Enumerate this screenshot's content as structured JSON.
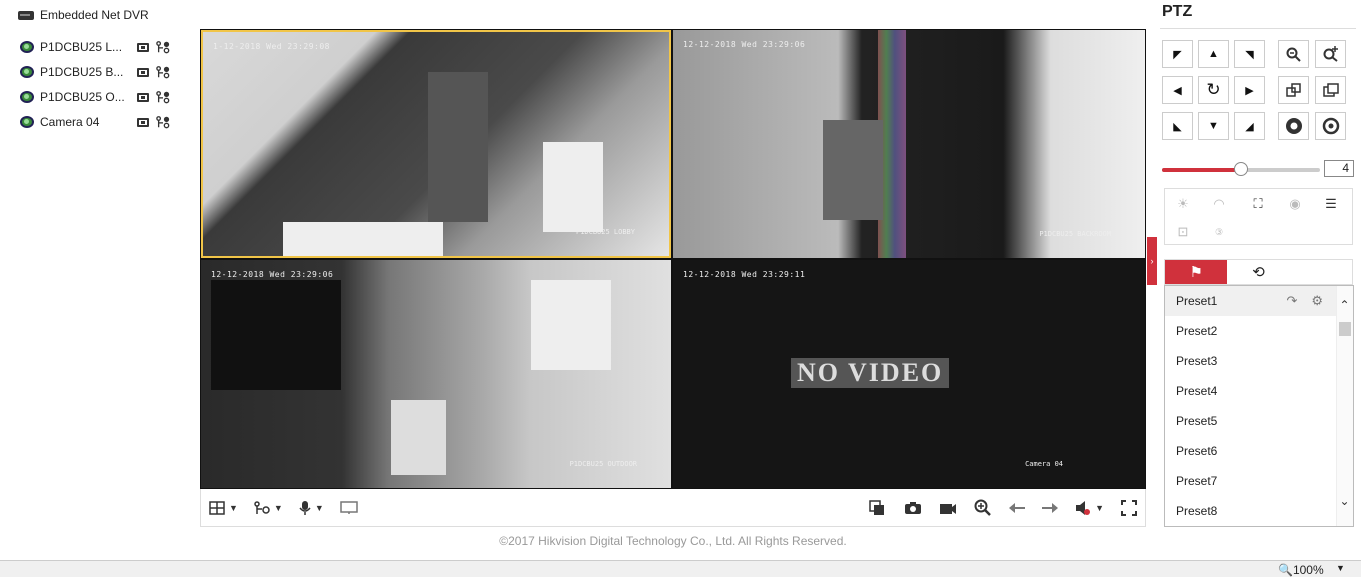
{
  "sidebar": {
    "device_title": "Embedded Net DVR",
    "cameras": [
      {
        "label": "P1DCBU25 L..."
      },
      {
        "label": "P1DCBU25 B..."
      },
      {
        "label": "P1DCBU25 O..."
      },
      {
        "label": "Camera 04"
      }
    ]
  },
  "tiles": [
    {
      "timestamp": "1-12-2018 Wed 23:29:08",
      "name": "P1DCBU25 LOBBY"
    },
    {
      "timestamp": "12-12-2018 Wed 23:29:06",
      "name": "P1DCBU25 BACKROOM"
    },
    {
      "timestamp": "12-12-2018 Wed 23:29:06",
      "name": "P1DCBU25 OUTDOOR"
    },
    {
      "timestamp": "12-12-2018 Wed 23:29:11",
      "name": "Camera 04",
      "overlay": "NO VIDEO"
    }
  ],
  "ptz": {
    "title": "PTZ",
    "speed_value": "4",
    "speed_fraction": 0.5,
    "presets": [
      "Preset1",
      "Preset2",
      "Preset3",
      "Preset4",
      "Preset5",
      "Preset6",
      "Preset7",
      "Preset8"
    ]
  },
  "footer": {
    "copyright": "©2017 Hikvision Digital Technology Co., Ltd. All Rights Reserved."
  },
  "statusbar": {
    "zoom": "100%"
  },
  "colors": {
    "accent": "#d0313c",
    "selected_border": "#f1c548"
  }
}
